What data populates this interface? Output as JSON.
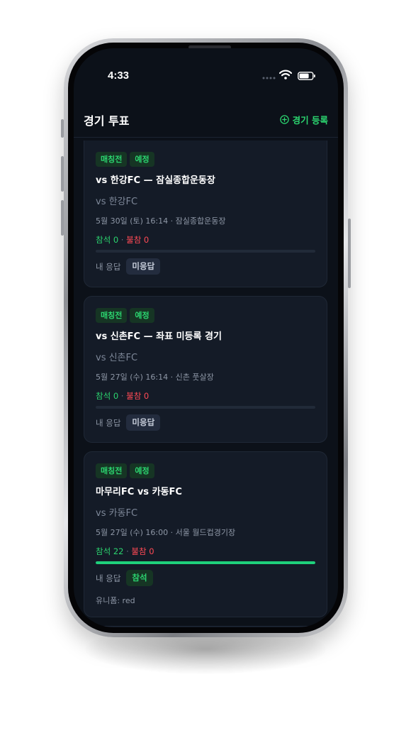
{
  "status_bar": {
    "time": "4:33"
  },
  "header": {
    "title": "경기 투표",
    "register_label": "경기 등록",
    "register_icon": "plus-circle-icon"
  },
  "colors": {
    "background": "#0c1119",
    "card": "#141b27",
    "accent_green": "#2bd46f",
    "absent_red": "#ff4a55",
    "chip_none": "#232c3e"
  },
  "matches": [
    {
      "badges": [
        "매칭전",
        "예정"
      ],
      "title": "vs 한강FC — 잠실종합운동장",
      "opponent": "vs 한강FC",
      "meta": "5월 30일 (토) 16:14 · 잠실종합운동장",
      "attend_text": "참석 0",
      "absent_text": "불참 0",
      "attend_ratio": 0,
      "response_label": "내 응답",
      "response": "미응답"
    },
    {
      "badges": [
        "매칭전",
        "예정"
      ],
      "title": "vs 신촌FC — 좌표 미등록 경기",
      "opponent": "vs 신촌FC",
      "meta": "5월 27일 (수) 16:14 · 신촌 풋살장",
      "attend_text": "참석 0",
      "absent_text": "불참 0",
      "attend_ratio": 0,
      "response_label": "내 응답",
      "response": "미응답"
    },
    {
      "badges": [
        "매칭전",
        "예정"
      ],
      "title": "마무리FC vs 카동FC",
      "opponent": "vs 카동FC",
      "meta": "5월 27일 (수) 16:00 · 서울 월드컵경기장",
      "attend_text": "참석 22",
      "absent_text": "불참 0",
      "attend_ratio": 1,
      "response_label": "내 응답",
      "response": "참석",
      "uniform": "유니폼: red"
    }
  ]
}
